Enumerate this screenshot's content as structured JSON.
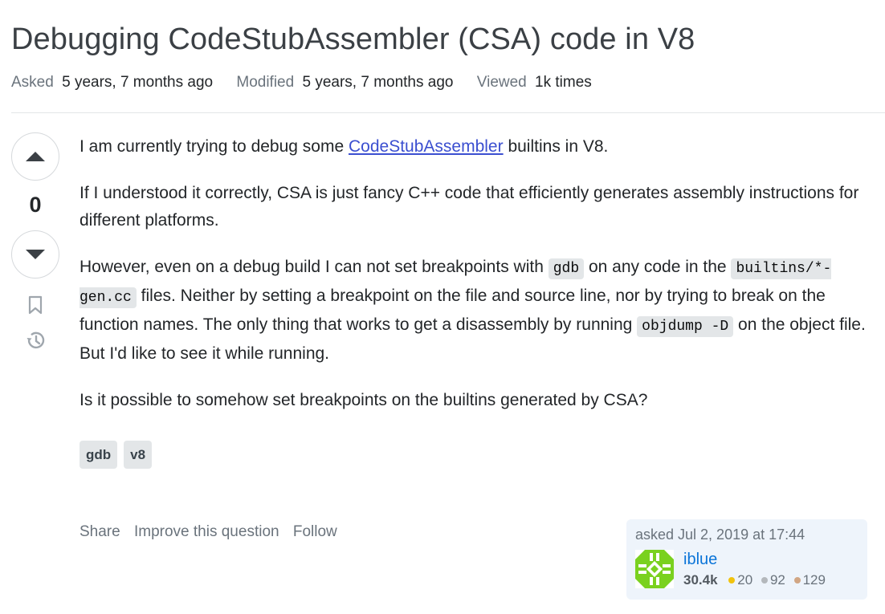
{
  "question": {
    "title": "Debugging CodeStubAssembler (CSA) code in V8",
    "meta": {
      "asked_label": "Asked",
      "asked_value": "5 years, 7 months ago",
      "modified_label": "Modified",
      "modified_value": "5 years, 7 months ago",
      "viewed_label": "Viewed",
      "viewed_value": "1k times"
    },
    "votes": {
      "count": "0"
    },
    "body": {
      "p1_before": "I am currently trying to debug some ",
      "p1_link": "CodeStubAssembler",
      "p1_after": " builtins in V8.",
      "p2": "If I understood it correctly, CSA is just fancy C++ code that efficiently generates assembly instructions for different platforms.",
      "p3_a": "However, even on a debug build I can not set breakpoints with ",
      "p3_code1": "gdb",
      "p3_b": " on any code in the ",
      "p3_code2": "builtins/*-gen.cc",
      "p3_c": " files. Neither by setting a breakpoint on the file and source line, nor by trying to break on the function names. The only thing that works to get a disassembly by running ",
      "p3_code3": "objdump -D",
      "p3_d": " on the object file. But I'd like to see it while running.",
      "p4": "Is it possible to somehow set breakpoints on the builtins generated by CSA?"
    },
    "tags": [
      "gdb",
      "v8"
    ],
    "actions": {
      "share": "Share",
      "improve": "Improve this question",
      "follow": "Follow"
    },
    "owner": {
      "asked": "asked Jul 2, 2019 at 17:44",
      "name": "iblue",
      "reputation": "30.4k",
      "gold": "20",
      "silver": "92",
      "bronze": "129",
      "avatar_color": "#7ad11f"
    }
  },
  "icons": [
    "upvote-icon",
    "downvote-icon",
    "bookmark-icon",
    "history-icon"
  ]
}
